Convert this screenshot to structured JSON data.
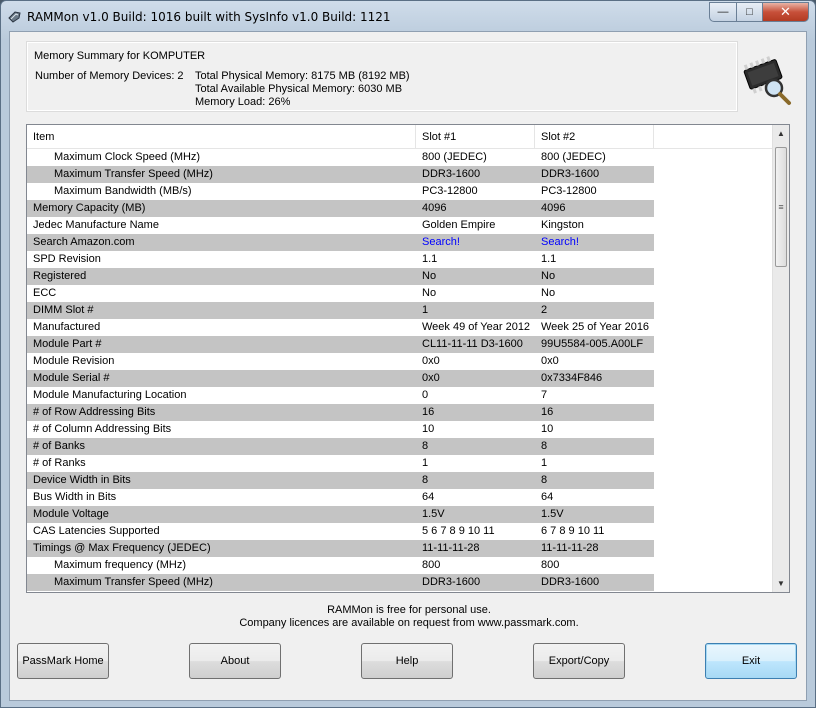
{
  "window": {
    "title": "RAMMon v1.0 Build: 1016 built with SysInfo v1.0 Build: 1121"
  },
  "caption": {
    "minimize": "—",
    "maximize": "□",
    "close": "✕"
  },
  "summary": {
    "title": "Memory Summary for KOMPUTER",
    "device_count": "Number of Memory Devices: 2",
    "total_physical": "Total Physical Memory: 8175 MB (8192 MB)",
    "total_available": "Total Available Physical Memory: 6030 MB",
    "memory_load": "Memory Load: 26%"
  },
  "table": {
    "headers": [
      "Item",
      "Slot #1",
      "Slot #2"
    ],
    "rows": [
      {
        "item": "Maximum Clock Speed (MHz)",
        "s1": "800 (JEDEC)",
        "s2": "800 (JEDEC)",
        "indent": true
      },
      {
        "item": "Maximum Transfer Speed (MHz)",
        "s1": "DDR3-1600",
        "s2": "DDR3-1600",
        "indent": true
      },
      {
        "item": "Maximum Bandwidth (MB/s)",
        "s1": "PC3-12800",
        "s2": "PC3-12800",
        "indent": true
      },
      {
        "item": "Memory Capacity (MB)",
        "s1": "4096",
        "s2": "4096"
      },
      {
        "item": "Jedec Manufacture Name",
        "s1": "Golden Empire",
        "s2": "Kingston"
      },
      {
        "item": "Search Amazon.com",
        "s1": "Search!",
        "s2": "Search!",
        "link": true
      },
      {
        "item": "SPD Revision",
        "s1": "1.1",
        "s2": "1.1"
      },
      {
        "item": "Registered",
        "s1": "No",
        "s2": "No"
      },
      {
        "item": "ECC",
        "s1": "No",
        "s2": "No"
      },
      {
        "item": "DIMM Slot #",
        "s1": "1",
        "s2": "2"
      },
      {
        "item": "Manufactured",
        "s1": "Week 49 of Year 2012",
        "s2": "Week 25 of Year 2016"
      },
      {
        "item": "Module Part #",
        "s1": "CL11-11-11 D3-1600",
        "s2": "99U5584-005.A00LF"
      },
      {
        "item": "Module Revision",
        "s1": "0x0",
        "s2": "0x0"
      },
      {
        "item": "Module Serial #",
        "s1": "0x0",
        "s2": "0x7334F846"
      },
      {
        "item": "Module Manufacturing Location",
        "s1": "0",
        "s2": "7"
      },
      {
        "item": "# of Row Addressing Bits",
        "s1": "16",
        "s2": "16"
      },
      {
        "item": "# of Column Addressing Bits",
        "s1": "10",
        "s2": "10"
      },
      {
        "item": "# of Banks",
        "s1": "8",
        "s2": "8"
      },
      {
        "item": "# of Ranks",
        "s1": "1",
        "s2": "1"
      },
      {
        "item": "Device Width in Bits",
        "s1": "8",
        "s2": "8"
      },
      {
        "item": "Bus Width in Bits",
        "s1": "64",
        "s2": "64"
      },
      {
        "item": "Module Voltage",
        "s1": "1.5V",
        "s2": "1.5V"
      },
      {
        "item": "CAS Latencies Supported",
        "s1": "5 6 7 8 9 10 11",
        "s2": "6 7 8 9 10 11"
      },
      {
        "item": "Timings @ Max Frequency (JEDEC)",
        "s1": "11-11-11-28",
        "s2": "11-11-11-28"
      },
      {
        "item": "Maximum frequency (MHz)",
        "s1": "800",
        "s2": "800",
        "indent": true
      },
      {
        "item": "Maximum Transfer Speed (MHz)",
        "s1": "DDR3-1600",
        "s2": "DDR3-1600",
        "indent": true
      }
    ]
  },
  "scrollbar": {
    "up": "▲",
    "down": "▼",
    "grip": "≡"
  },
  "footer": {
    "line1": "RAMMon is free for personal use.",
    "line2": "Company licences are available on request from www.passmark.com."
  },
  "buttons": {
    "passmark_home": "PassMark Home",
    "about": "About",
    "help": "Help",
    "export_copy": "Export/Copy",
    "exit": "Exit"
  }
}
